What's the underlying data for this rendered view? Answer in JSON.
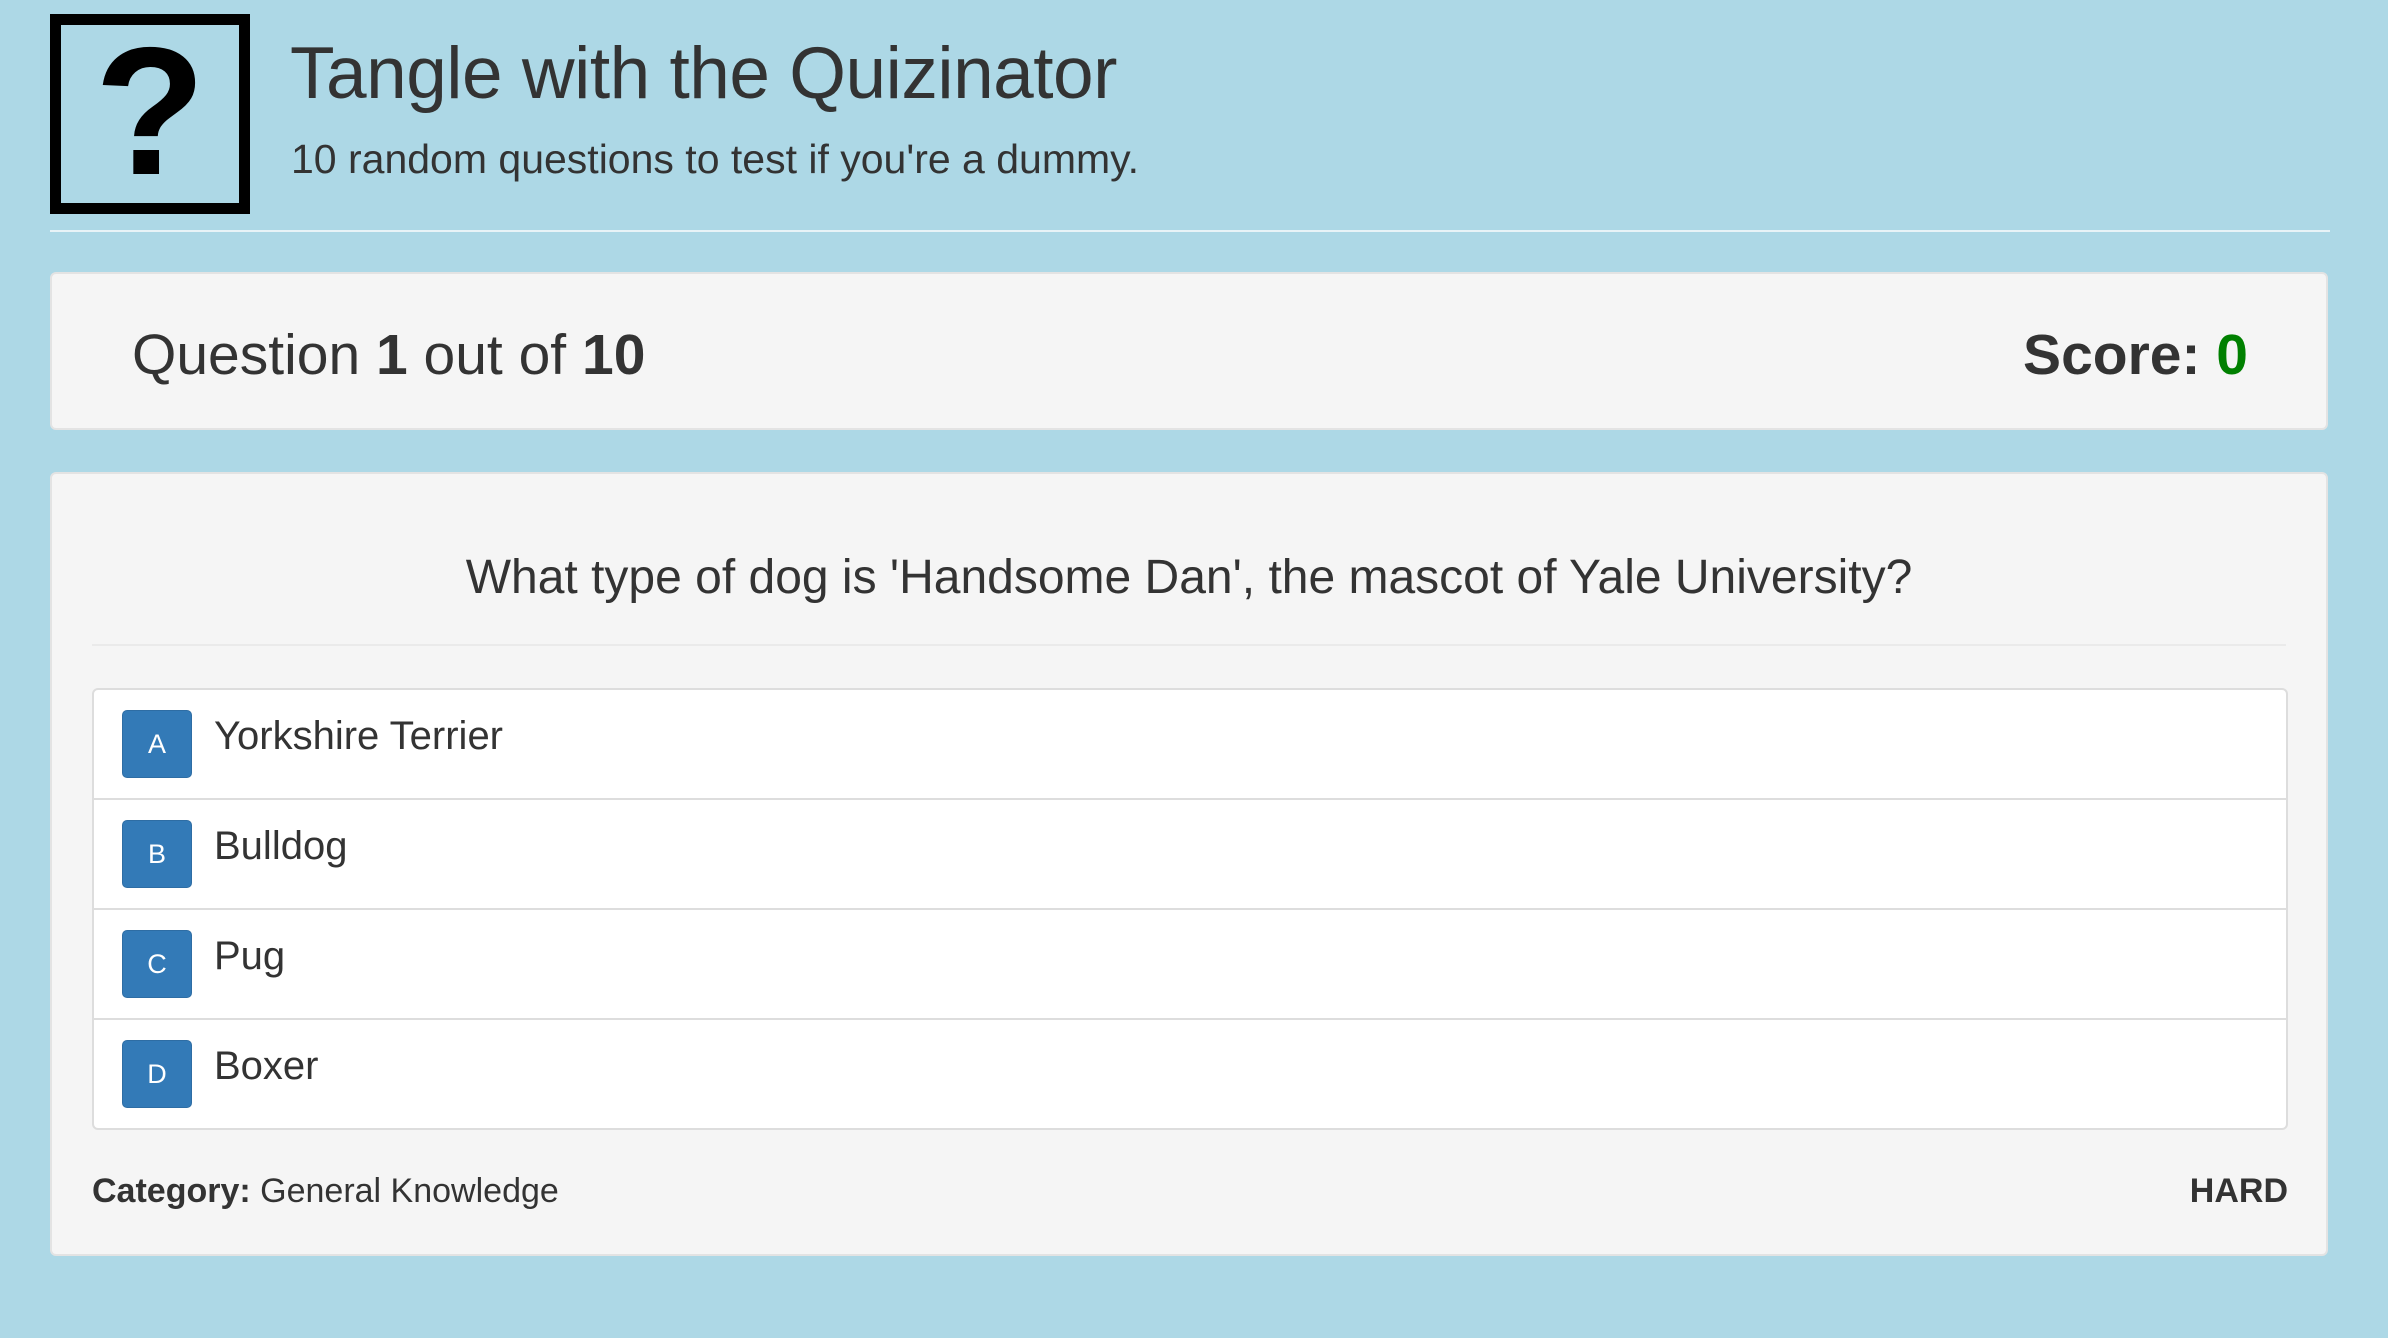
{
  "header": {
    "logo_glyph": "?",
    "title": "Tangle with the Quizinator",
    "subtitle": "10 random questions to test if you're a dummy."
  },
  "status": {
    "question_prefix": "Question",
    "current_question": "1",
    "out_of_text": "out of",
    "total_questions": "10",
    "score_label": "Score:",
    "score_value": "0"
  },
  "question": {
    "text": "What type of dog is 'Handsome Dan', the mascot of Yale University?",
    "answers": [
      {
        "letter": "A",
        "label": "Yorkshire Terrier"
      },
      {
        "letter": "B",
        "label": "Bulldog"
      },
      {
        "letter": "C",
        "label": "Pug"
      },
      {
        "letter": "D",
        "label": "Boxer"
      }
    ],
    "category_label": "Category:",
    "category_value": "General Knowledge",
    "difficulty": "HARD"
  },
  "colors": {
    "page_background": "#add8e6",
    "panel_background": "#f5f5f5",
    "answer_badge": "#337ab7",
    "score_value": "#008000",
    "text": "#333333"
  },
  "icons": {
    "logo": "question-mark-icon"
  }
}
